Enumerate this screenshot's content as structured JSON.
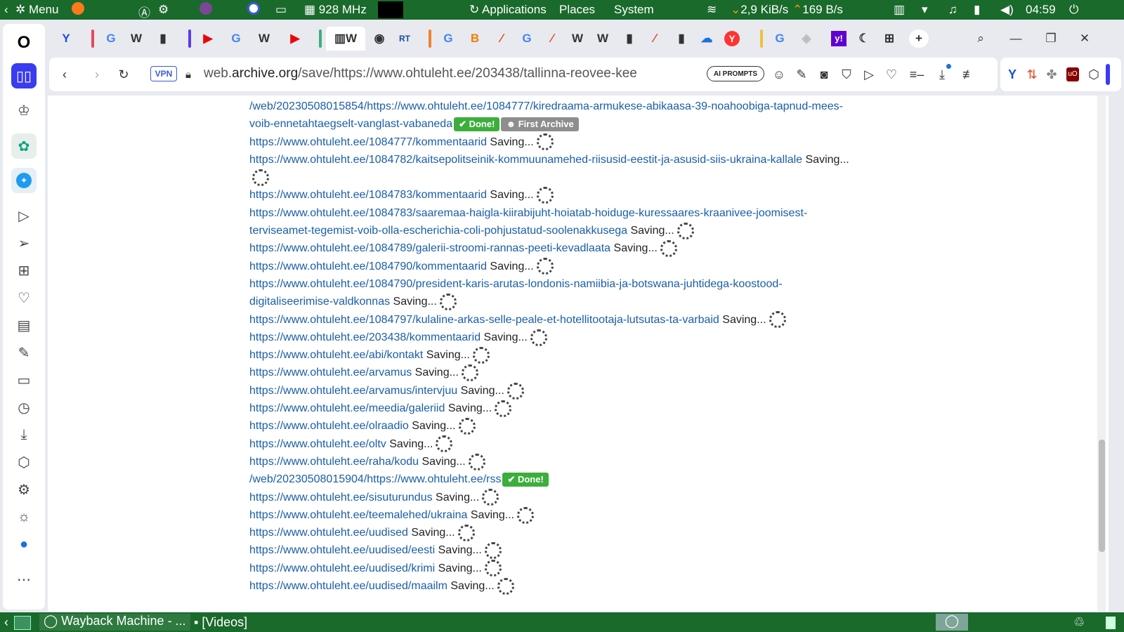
{
  "os_panel": {
    "menu_label": "Menu",
    "cpu_freq": "928 MHz",
    "applications": "Applications",
    "places": "Places",
    "system": "System",
    "net_down": "2,9 KiB/s",
    "net_up": "169 B/s",
    "clock": "04:59"
  },
  "browser": {
    "url_domain_prefix": "web.",
    "url_domain": "archive.org",
    "url_rest": "/save/https://www.ohtuleht.ee/203438/tallinna-reovee-kee",
    "vpn_label": "VPN",
    "ai_prompts_label": "AI PROMPTS",
    "tab_letters": [
      "W",
      "W",
      "W",
      "W"
    ]
  },
  "content": {
    "saving_label": "Saving...",
    "done_label": "Done!",
    "first_archive_label": "First Archive",
    "lines": [
      {
        "link": "/web/20230508015854/https://www.ohtuleht.ee/1084777/kiredraama-armukese-abikaasa-39-noahoobiga-tapnud-mees-",
        "status": ""
      },
      {
        "link": "voib-ennetahtaegselt-vanglast-vabaneda",
        "status": "done_first"
      },
      {
        "link": "https://www.ohtuleht.ee/1084777/kommentaarid",
        "status": "saving"
      },
      {
        "link": "https://www.ohtuleht.ee/1084782/kaitsepolitseinik-kommuunamehed-riisusid-eestit-ja-asusid-siis-ukraina-kallale",
        "status": "saving_text"
      },
      {
        "link": "",
        "status": "spinner_only"
      },
      {
        "link": "https://www.ohtuleht.ee/1084783/kommentaarid",
        "status": "saving"
      },
      {
        "link": "https://www.ohtuleht.ee/1084783/saaremaa-haigla-kiirabijuht-hoiatab-hoiduge-kuressaares-kraanivee-joomisest-",
        "status": ""
      },
      {
        "link": "terviseamet-tegemist-voib-olla-escherichia-coli-pohjustatud-soolenakkusega",
        "status": "saving"
      },
      {
        "link": "https://www.ohtuleht.ee/1084789/galerii-stroomi-rannas-peeti-kevadlaata",
        "status": "saving"
      },
      {
        "link": "https://www.ohtuleht.ee/1084790/kommentaarid",
        "status": "saving"
      },
      {
        "link": "https://www.ohtuleht.ee/1084790/president-karis-arutas-londonis-namiibia-ja-botswana-juhtidega-koostood-",
        "status": ""
      },
      {
        "link": "digitaliseerimise-valdkonnas",
        "status": "saving"
      },
      {
        "link": "https://www.ohtuleht.ee/1084797/kulaline-arkas-selle-peale-et-hotellitootaja-lutsutas-ta-varbaid",
        "status": "saving"
      },
      {
        "link": "https://www.ohtuleht.ee/203438/kommentaarid",
        "status": "saving"
      },
      {
        "link": "https://www.ohtuleht.ee/abi/kontakt",
        "status": "saving"
      },
      {
        "link": "https://www.ohtuleht.ee/arvamus",
        "status": "saving"
      },
      {
        "link": "https://www.ohtuleht.ee/arvamus/intervjuu",
        "status": "saving"
      },
      {
        "link": "https://www.ohtuleht.ee/meedia/galeriid",
        "status": "saving"
      },
      {
        "link": "https://www.ohtuleht.ee/olraadio",
        "status": "saving"
      },
      {
        "link": "https://www.ohtuleht.ee/oltv",
        "status": "saving"
      },
      {
        "link": "https://www.ohtuleht.ee/raha/kodu",
        "status": "saving"
      },
      {
        "link": "/web/20230508015904/https://www.ohtuleht.ee/rss",
        "status": "done"
      },
      {
        "link": "https://www.ohtuleht.ee/sisuturundus",
        "status": "saving"
      },
      {
        "link": "https://www.ohtuleht.ee/teemalehed/ukraina",
        "status": "saving"
      },
      {
        "link": "https://www.ohtuleht.ee/uudised",
        "status": "saving"
      },
      {
        "link": "https://www.ohtuleht.ee/uudised/eesti",
        "status": "saving"
      },
      {
        "link": "https://www.ohtuleht.ee/uudised/krimi",
        "status": "saving"
      },
      {
        "link": "https://www.ohtuleht.ee/uudised/maailm",
        "status": "saving"
      }
    ]
  },
  "taskbar": {
    "window1": "Wayback Machine - ...",
    "window2": "[Videos]"
  },
  "colors": {
    "panel": "#1a6a2c",
    "link": "#1a5ea8",
    "done": "#3cae3c",
    "accent": "#3b3bf0"
  }
}
